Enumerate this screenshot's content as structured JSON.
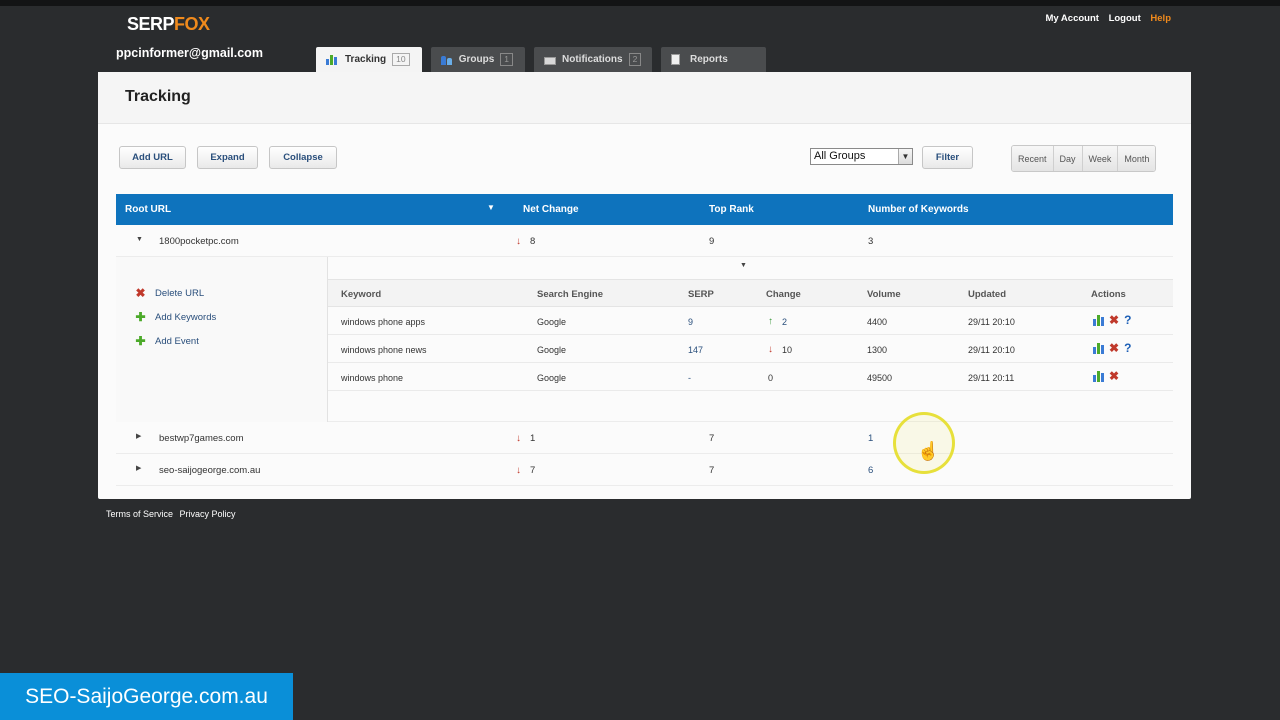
{
  "brand": {
    "part1": "SERP",
    "part2": "FOX"
  },
  "user_email": "ppcinformer@gmail.com",
  "top_links": {
    "account": "My Account",
    "logout": "Logout",
    "help": "Help"
  },
  "tabs": [
    {
      "label": "Tracking",
      "count": "10"
    },
    {
      "label": "Groups",
      "count": "1"
    },
    {
      "label": "Notifications",
      "count": "2"
    },
    {
      "label": "Reports"
    }
  ],
  "page_title": "Tracking",
  "toolbar": {
    "add_url": "Add URL",
    "expand": "Expand",
    "collapse": "Collapse",
    "group_select": "All Groups",
    "filter": "Filter",
    "ranges": [
      "Recent",
      "Day",
      "Week",
      "Month"
    ]
  },
  "table": {
    "headers": {
      "root_url": "Root URL",
      "net_change": "Net Change",
      "top_rank": "Top Rank",
      "keywords": "Number of Keywords"
    },
    "rows": [
      {
        "url": "1800pocketpc.com",
        "net_change": "8",
        "top_rank": "9",
        "keywords": "3"
      },
      {
        "url": "bestwp7games.com",
        "net_change": "1",
        "top_rank": "7",
        "keywords": "1"
      },
      {
        "url": "seo-saijogeorge.com.au",
        "net_change": "7",
        "top_rank": "7",
        "keywords": "6"
      }
    ]
  },
  "detail": {
    "actions": [
      "Delete URL",
      "Add Keywords",
      "Add Event"
    ],
    "headers": [
      "Keyword",
      "Search Engine",
      "SERP",
      "Change",
      "Volume",
      "Updated",
      "Actions"
    ],
    "rows": [
      {
        "keyword": "windows phone apps",
        "engine": "Google",
        "serp": "9",
        "change": "2",
        "direction": "up",
        "volume": "4400",
        "updated": "29/11 20:10"
      },
      {
        "keyword": "windows phone news",
        "engine": "Google",
        "serp": "147",
        "change": "10",
        "direction": "down",
        "volume": "1300",
        "updated": "29/11 20:10"
      },
      {
        "keyword": "windows phone",
        "engine": "Google",
        "serp": "-",
        "change": "0",
        "direction": "none",
        "volume": "49500",
        "updated": "29/11 20:11"
      }
    ]
  },
  "footer": {
    "terms": "Terms of Service",
    "privacy": "Privacy Policy"
  },
  "watermark": "SEO-SaijoGeorge.com.au",
  "colors": {
    "brand_orange": "#f08a1c",
    "header_blue": "#0e73bd",
    "down_red": "#c0392b",
    "up_green": "#3c9a3c",
    "watermark_blue": "#0a8fd8"
  }
}
